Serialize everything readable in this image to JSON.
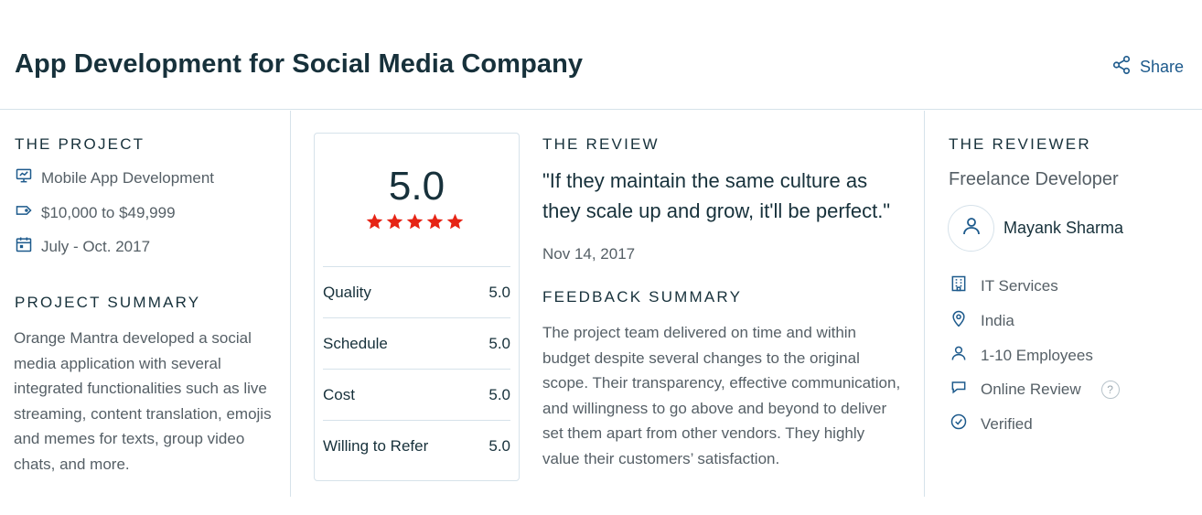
{
  "header": {
    "title": "App Development for Social Media Company",
    "share_label": "Share"
  },
  "project": {
    "section_label": "THE PROJECT",
    "service": "Mobile App Development",
    "budget": "$10,000 to $49,999",
    "dates": "July - Oct. 2017",
    "summary_label": "PROJECT SUMMARY",
    "summary": "Orange Mantra developed a social media application with several integrated functionalities such as live streaming, content translation, emojis and memes for texts, group video chats, and more."
  },
  "rating": {
    "overall": "5.0",
    "stars": 5,
    "star_color": "#e62415",
    "rows": [
      {
        "label": "Quality",
        "value": "5.0"
      },
      {
        "label": "Schedule",
        "value": "5.0"
      },
      {
        "label": "Cost",
        "value": "5.0"
      },
      {
        "label": "Willing to Refer",
        "value": "5.0"
      }
    ]
  },
  "review": {
    "section_label": "THE REVIEW",
    "quote": "\"If they maintain the same culture as they scale up and grow, it'll be perfect.\"",
    "date": "Nov 14, 2017",
    "feedback_label": "FEEDBACK SUMMARY",
    "feedback": "The project team delivered on time and within budget despite several changes to the original scope. Their transparency, effective communication, and willingness to go above and beyond to deliver set them apart from other vendors. They highly value their customers’ satisfaction."
  },
  "reviewer": {
    "section_label": "THE REVIEWER",
    "role": "Freelance Developer",
    "name": "Mayank Sharma",
    "industry": "IT Services",
    "location": "India",
    "company_size": "1-10 Employees",
    "review_type": "Online Review",
    "help_glyph": "?",
    "verified": "Verified"
  },
  "icons": {
    "share": "share-icon",
    "service": "presentation-icon",
    "budget": "price-tag-icon",
    "dates": "calendar-icon",
    "avatar": "user-icon",
    "industry": "building-icon",
    "location": "location-pin-icon",
    "company_size": "person-icon",
    "review_type": "chat-bubble-icon",
    "verified": "check-circle-icon"
  },
  "colors": {
    "link": "#1d5a8c",
    "heading": "#17313b",
    "body_text": "#555f66",
    "border": "#d6e2ea"
  }
}
